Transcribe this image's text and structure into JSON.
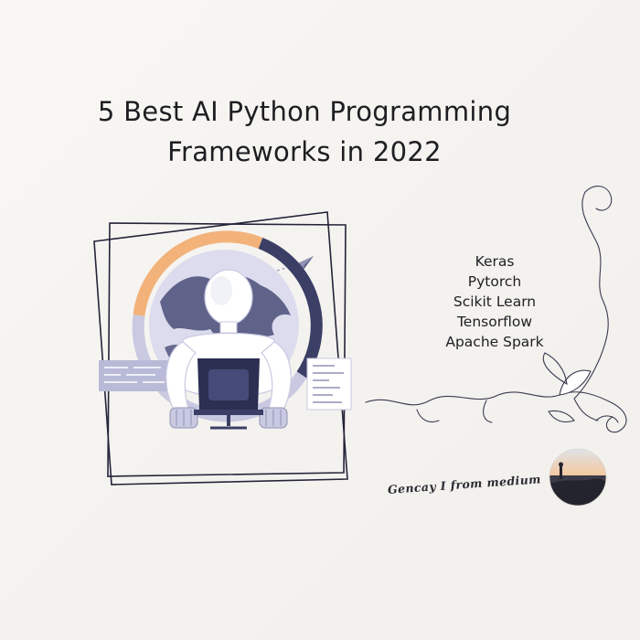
{
  "title": {
    "line1": "5 Best AI Python Programming",
    "line2": "Frameworks in 2022"
  },
  "frameworks": [
    "Keras",
    "Pytorch",
    "Scikit Learn",
    "Tensorflow",
    "Apache Spark"
  ],
  "credit": "Gencay I from medium",
  "colors": {
    "text": "#1e1e22",
    "navy": "#3b3f66",
    "lavender": "#a9a9d0",
    "orange": "#f2b27a",
    "frame": "#23233a"
  },
  "illustration": {
    "subject": "robot-sitting-at-laptop",
    "ring": "orange-and-navy-progress-ring"
  }
}
